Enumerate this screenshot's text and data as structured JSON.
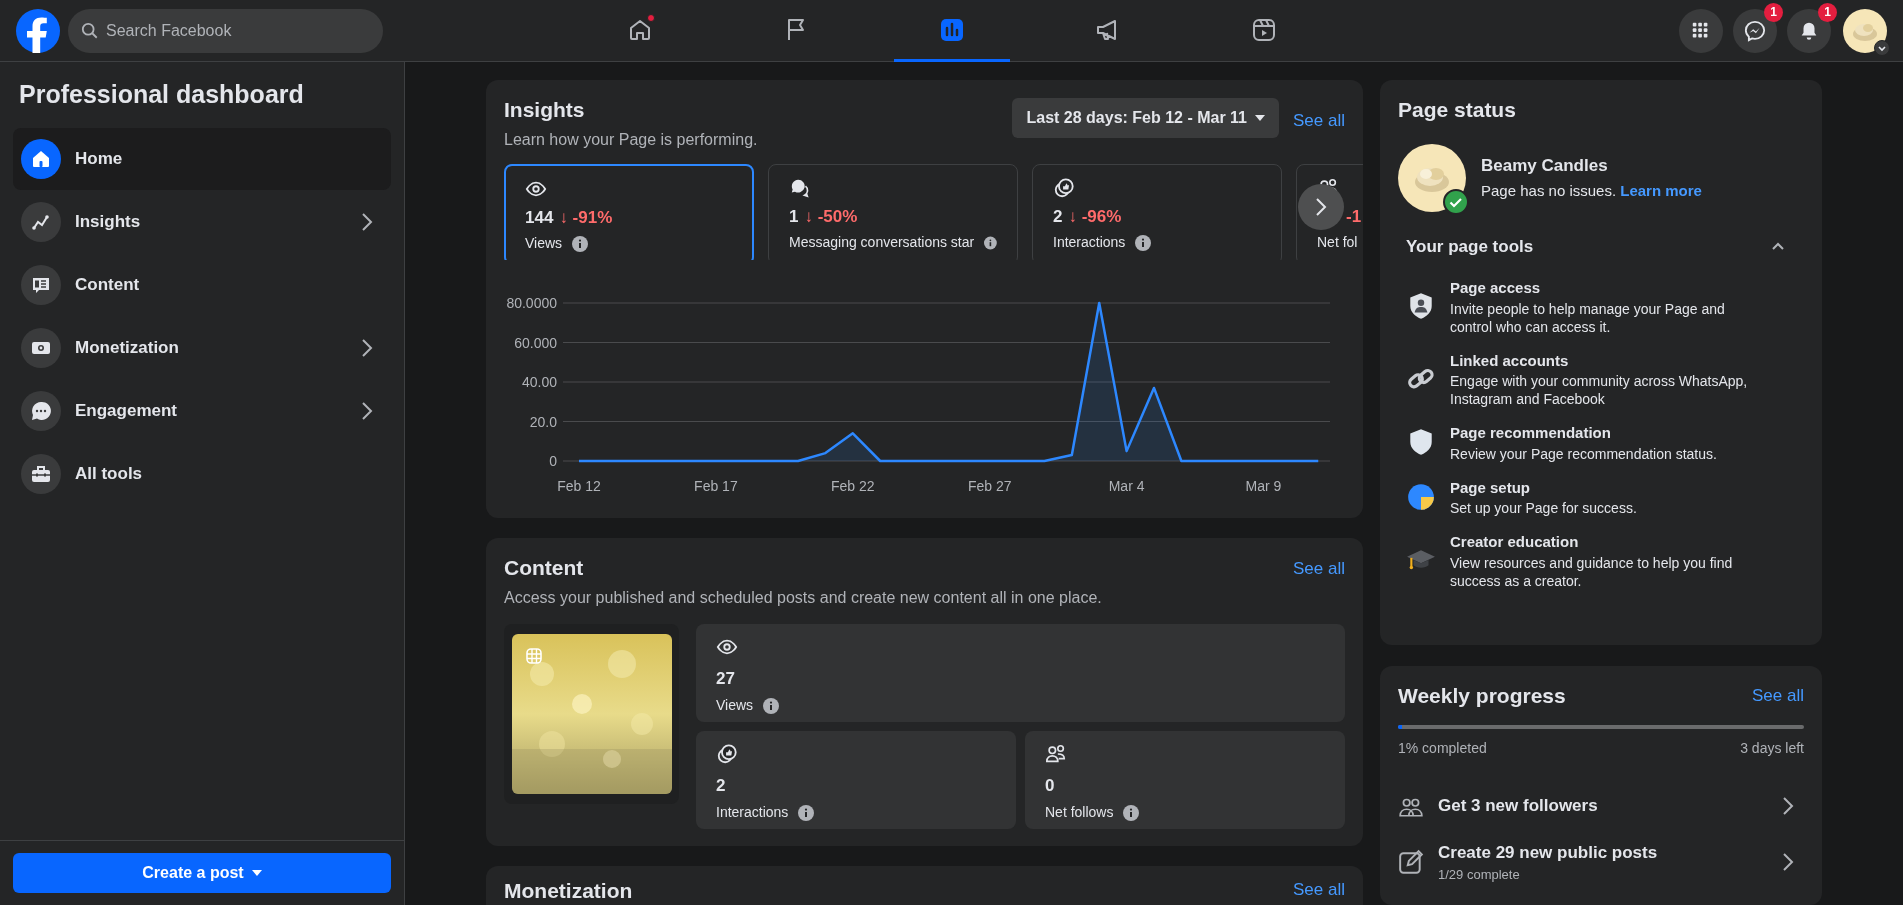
{
  "topbar": {
    "search": {
      "placeholder": "Search Facebook"
    },
    "nav_tabs": [
      {
        "kind": "home",
        "selected": false,
        "dot": true
      },
      {
        "kind": "flag",
        "selected": false,
        "dot": false
      },
      {
        "kind": "dashboard",
        "selected": true,
        "dot": false
      },
      {
        "kind": "megaphone",
        "selected": false,
        "dot": false
      },
      {
        "kind": "video",
        "selected": false,
        "dot": false
      }
    ],
    "actions": [
      {
        "kind": "menu"
      },
      {
        "kind": "messenger",
        "badge": "1"
      },
      {
        "kind": "bell",
        "badge": "1"
      }
    ]
  },
  "sidebar": {
    "title": "Professional dashboard",
    "items": [
      {
        "kind": "home",
        "label": "Home",
        "selected": true,
        "chevron": false
      },
      {
        "kind": "insights",
        "label": "Insights",
        "selected": false,
        "chevron": true
      },
      {
        "kind": "content",
        "label": "Content",
        "selected": false,
        "chevron": false
      },
      {
        "kind": "money",
        "label": "Monetization",
        "selected": false,
        "chevron": true
      },
      {
        "kind": "chat",
        "label": "Engagement",
        "selected": false,
        "chevron": true
      },
      {
        "kind": "tools",
        "label": "All tools",
        "selected": false,
        "chevron": false
      }
    ],
    "create_button": "Create a post"
  },
  "insights": {
    "title": "Insights",
    "subtitle": "Learn how your Page is performing.",
    "date_range": "Last 28 days: Feb 12 - Mar 11",
    "see_all": "See all",
    "metrics": [
      {
        "kind": "eye",
        "value": "144",
        "change": "↓ -91%",
        "label": "Views",
        "selected": true
      },
      {
        "kind": "chat",
        "value": "1",
        "change": "↓ -50%",
        "label": "Messaging conversations star",
        "selected": false
      },
      {
        "kind": "like",
        "value": "2",
        "change": "↓ -96%",
        "label": "Interactions",
        "selected": false
      },
      {
        "kind": "people",
        "change": "-1",
        "label": "Net fol",
        "selected": false
      }
    ],
    "chart_data": {
      "type": "area",
      "categories": [
        "Feb 12",
        null,
        null,
        null,
        null,
        "Feb 17",
        null,
        null,
        null,
        null,
        "Feb 22",
        null,
        null,
        null,
        null,
        "Feb 27",
        null,
        null,
        null,
        null,
        "Mar 4",
        null,
        null,
        null,
        null,
        "Mar 9",
        null,
        null
      ],
      "series": [
        {
          "color": "#2d88ff",
          "values": [
            0,
            0,
            0,
            0,
            0,
            0,
            0,
            0,
            0,
            4,
            14,
            0,
            0,
            0,
            0,
            0,
            0,
            0,
            3,
            80,
            5,
            37,
            0,
            0,
            0,
            0,
            0,
            0
          ]
        }
      ],
      "ylim": [
        0,
        80
      ],
      "grid": true,
      "yticks": [
        {
          "value": 0,
          "label": "0"
        },
        {
          "value": 20,
          "label": "20.0"
        },
        {
          "value": 40,
          "label": "40.00"
        },
        {
          "value": 60,
          "label": "60.000"
        },
        {
          "value": 80,
          "label": "80.0000"
        }
      ]
    }
  },
  "content": {
    "title": "Content",
    "subtitle": "Access your published and scheduled posts and create new content all in one place.",
    "see_all": "See all",
    "stats": [
      {
        "kind": "eye",
        "value": "27",
        "label": "Views"
      },
      {
        "kind": "like",
        "value": "2",
        "label": "Interactions"
      },
      {
        "kind": "people",
        "value": "0",
        "label": "Net follows"
      }
    ]
  },
  "monetization": {
    "title": "Monetization",
    "see_all": "See all"
  },
  "page_status": {
    "title": "Page status",
    "page_name": "Beamy Candles",
    "status": "Page has no issues.",
    "learn_more": "Learn more",
    "tools_title": "Your page tools",
    "expanded": true,
    "tools": [
      {
        "kind": "shield-person",
        "title": "Page access",
        "description": "Invite people to help manage your Page and control who can access it."
      },
      {
        "kind": "link",
        "title": "Linked accounts",
        "description": "Engage with your community across WhatsApp, Instagram and Facebook"
      },
      {
        "kind": "shield",
        "title": "Page recommendation",
        "description": "Review your Page recommendation status."
      },
      {
        "kind": "setup",
        "title": "Page setup",
        "description": "Set up your Page for success."
      },
      {
        "kind": "cap",
        "title": "Creator education",
        "description": "View resources and guidance to help you find success as a creator."
      }
    ]
  },
  "weekly_progress": {
    "title": "Weekly progress",
    "see_all": "See all",
    "level": 0.01,
    "completed": "1% completed",
    "days_left": "3 days left",
    "tasks": [
      {
        "kind": "people",
        "title": "Get 3 new followers"
      },
      {
        "kind": "edit",
        "title": "Create 29 new public posts",
        "detail": "1/29 complete"
      }
    ]
  }
}
